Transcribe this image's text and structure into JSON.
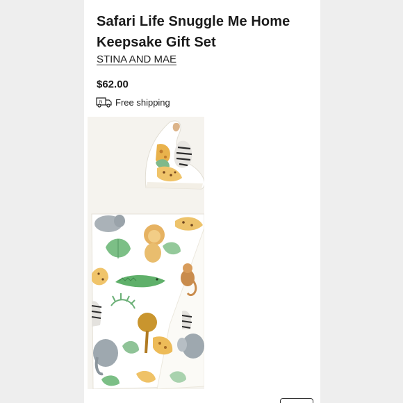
{
  "product": {
    "title": "Safari Life Snuggle Me Home Keepsake Gift Set",
    "brand": "STINA AND MAE",
    "price": "$62.00",
    "shipping": "Free shipping"
  },
  "icons": {
    "shipping": "truck-icon"
  },
  "image": {
    "subject": "product-photo-hat-and-swaddle-blanket"
  }
}
